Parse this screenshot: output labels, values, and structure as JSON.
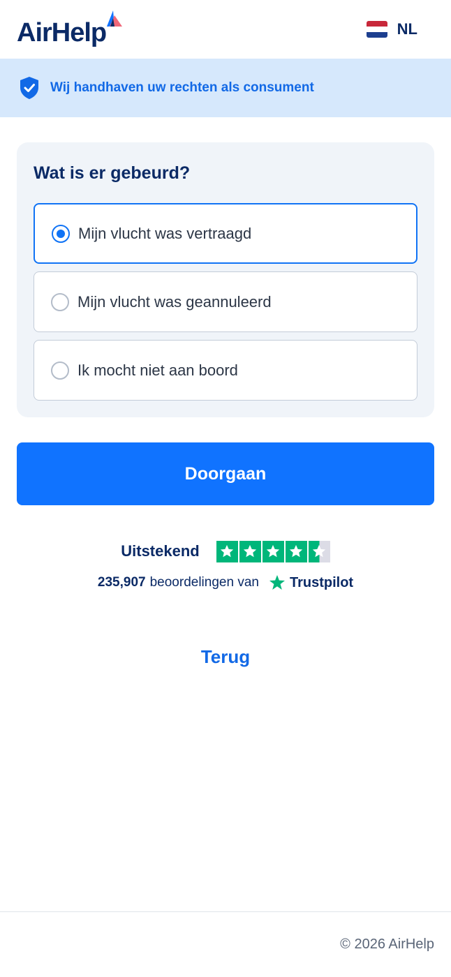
{
  "header": {
    "logo_text": "AirHelp",
    "language": "NL"
  },
  "banner": {
    "text": "Wij handhaven uw rechten als consument",
    "icon": "shield-check-icon"
  },
  "question": {
    "title": "Wat is er gebeurd?",
    "options": [
      {
        "label": "Mijn vlucht was vertraagd",
        "selected": true
      },
      {
        "label": "Mijn vlucht was geannuleerd",
        "selected": false
      },
      {
        "label": "Ik mocht niet aan boord",
        "selected": false
      }
    ]
  },
  "continue_label": "Doorgaan",
  "trustpilot": {
    "rating_word": "Uitstekend",
    "stars": 4.5,
    "review_count": "235,907",
    "reviews_text": "beoordelingen van",
    "brand": "Trustpilot"
  },
  "back_label": "Terug",
  "footer": {
    "copyright": "© 2026 AirHelp"
  },
  "colors": {
    "primary": "#1073ff",
    "navy": "#0b2a66",
    "banner_bg": "#d6e8fc",
    "trustpilot_green": "#00b67a"
  }
}
